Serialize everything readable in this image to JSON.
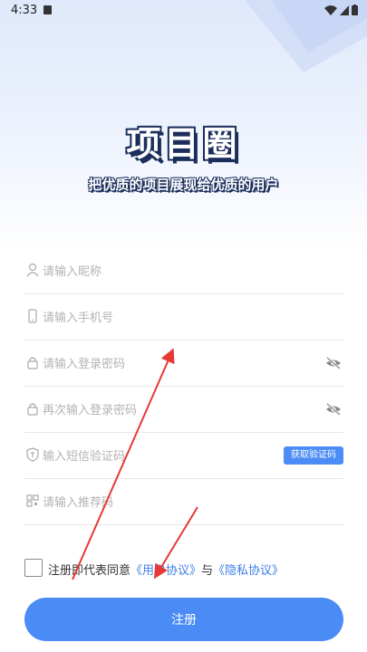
{
  "status_bar": {
    "time": "4:33"
  },
  "header": {
    "title": "项目圈",
    "slogan": "把优质的项目展现给优质的用户"
  },
  "form": {
    "nickname_placeholder": "请输入昵称",
    "phone_placeholder": "请输入手机号",
    "password_placeholder": "请输入登录密码",
    "confirm_password_placeholder": "再次输入登录密码",
    "sms_code_placeholder": "输入短信验证码",
    "get_code_label": "获取验证码",
    "referral_placeholder": "请输入推荐码"
  },
  "agreement": {
    "prefix": "注册即代表同意",
    "user_agreement": "《用户协议》",
    "conjunction": "与",
    "privacy_agreement": "《隐私协议》"
  },
  "submit_label": "注册",
  "colors": {
    "accent": "#4a8bf5",
    "link": "#3b7fe8",
    "annotation_arrow": "#e53935"
  }
}
